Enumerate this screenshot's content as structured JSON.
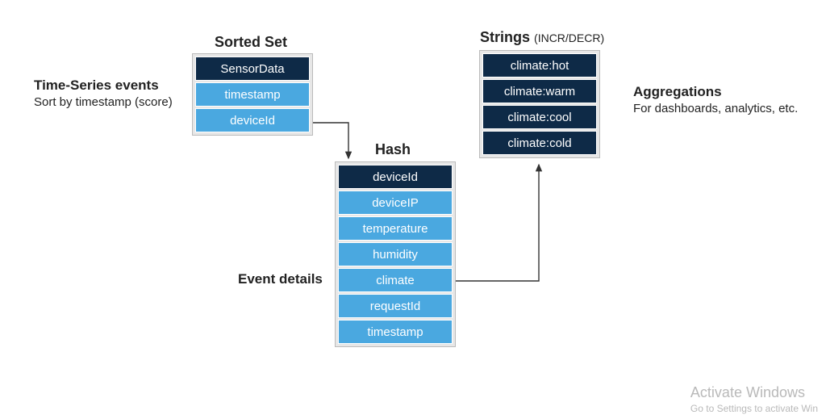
{
  "labels": {
    "timeSeries": {
      "title": "Time-Series events",
      "sub": "Sort by timestamp (score)"
    },
    "eventDetails": {
      "title": "Event details"
    },
    "aggregations": {
      "title": "Aggregations",
      "sub": "For dashboards, analytics, etc."
    }
  },
  "blocks": {
    "sortedSet": {
      "title": "Sorted Set",
      "cells": [
        {
          "text": "SensorData",
          "style": "dark"
        },
        {
          "text": "timestamp",
          "style": "light"
        },
        {
          "text": "deviceId",
          "style": "light"
        }
      ]
    },
    "hash": {
      "title": "Hash",
      "cells": [
        {
          "text": "deviceId",
          "style": "dark"
        },
        {
          "text": "deviceIP",
          "style": "light"
        },
        {
          "text": "temperature",
          "style": "light"
        },
        {
          "text": "humidity",
          "style": "light"
        },
        {
          "text": "climate",
          "style": "light"
        },
        {
          "text": "requestId",
          "style": "light"
        },
        {
          "text": "timestamp",
          "style": "light"
        }
      ]
    },
    "strings": {
      "title": "Strings",
      "titleParen": "(INCR/DECR)",
      "cells": [
        {
          "text": "climate:hot",
          "style": "dark"
        },
        {
          "text": "climate:warm",
          "style": "dark"
        },
        {
          "text": "climate:cool",
          "style": "dark"
        },
        {
          "text": "climate:cold",
          "style": "dark"
        }
      ]
    }
  },
  "watermark": {
    "line1": "Activate Windows",
    "line2": "Go to Settings to activate Win"
  }
}
